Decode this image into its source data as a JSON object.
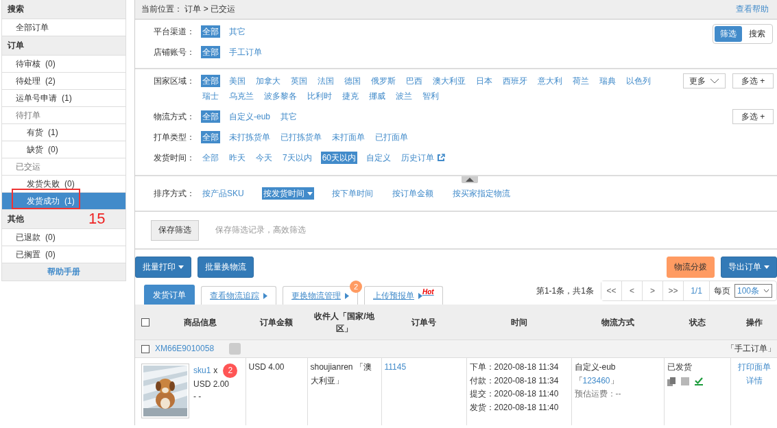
{
  "sidebar": {
    "sections": [
      {
        "title": "搜索",
        "items": [
          {
            "label": "全部订单",
            "selected": false
          }
        ]
      },
      {
        "title": "订单",
        "items": [
          {
            "label": "待审核",
            "count": "(0)",
            "selected": false
          },
          {
            "label": "待处理",
            "count": "(2)",
            "selected": false
          },
          {
            "label": "运单号申请",
            "count": "(1)",
            "selected": false
          },
          {
            "label": "待打单",
            "kind": "group",
            "selected": false,
            "children": [
              {
                "label": "有货",
                "count": "(1)",
                "selected": false
              },
              {
                "label": "缺货",
                "count": "(0)",
                "selected": false
              }
            ]
          },
          {
            "label": "已交运",
            "kind": "group",
            "selected": false,
            "children": [
              {
                "label": "发货失败",
                "count": "(0)",
                "selected": false
              },
              {
                "label": "发货成功",
                "count": "(1)",
                "selected": true
              }
            ]
          }
        ]
      },
      {
        "title": "其他",
        "items": [
          {
            "label": "已退款",
            "count": "(0)",
            "selected": false
          },
          {
            "label": "已搁置",
            "count": "(0)",
            "selected": false
          }
        ]
      }
    ],
    "help_link": "帮助手册",
    "annotation": {
      "label": "15"
    }
  },
  "breadcrumb": {
    "label": "当前位置：",
    "path": [
      "订单",
      "已交运"
    ],
    "separator": ">"
  },
  "help_link": "查看帮助",
  "filters": {
    "mode_toggle": [
      {
        "label": "筛选",
        "selected": true
      },
      {
        "label": "搜索",
        "selected": false
      }
    ],
    "groups": [
      {
        "rows": [
          {
            "label": "平台渠道：",
            "options": [
              {
                "label": "全部",
                "selected": true
              },
              {
                "label": "其它",
                "selected": false
              }
            ]
          },
          {
            "label": "店铺账号：",
            "options": [
              {
                "label": "全部",
                "selected": true
              },
              {
                "label": "手工订单",
                "selected": false
              }
            ]
          }
        ]
      },
      {
        "rows": [
          {
            "label": "国家区域：",
            "options": [
              {
                "label": "全部",
                "selected": true
              },
              {
                "label": "美国",
                "selected": false
              },
              {
                "label": "加拿大",
                "selected": false
              },
              {
                "label": "英国",
                "selected": false
              },
              {
                "label": "法国",
                "selected": false
              },
              {
                "label": "德国",
                "selected": false
              },
              {
                "label": "俄罗斯",
                "selected": false
              },
              {
                "label": "巴西",
                "selected": false
              },
              {
                "label": "澳大利亚",
                "selected": false
              },
              {
                "label": "日本",
                "selected": false
              },
              {
                "label": "西班牙",
                "selected": false
              },
              {
                "label": "意大利",
                "selected": false
              },
              {
                "label": "荷兰",
                "selected": false
              },
              {
                "label": "瑞典",
                "selected": false
              },
              {
                "label": "以色列",
                "selected": false
              },
              {
                "label": "瑞士",
                "selected": false
              },
              {
                "label": "乌克兰",
                "selected": false
              },
              {
                "label": "波多黎各",
                "selected": false
              },
              {
                "label": "比利时",
                "selected": false
              },
              {
                "label": "捷克",
                "selected": false
              },
              {
                "label": "挪威",
                "selected": false
              },
              {
                "label": "波兰",
                "selected": false
              },
              {
                "label": "智利",
                "selected": false
              }
            ],
            "buttons": [
              {
                "label": "更多",
                "kind": "dropdown"
              },
              {
                "label": "多选 +",
                "kind": "plain"
              }
            ]
          },
          {
            "label": "物流方式：",
            "options": [
              {
                "label": "全部",
                "selected": true
              },
              {
                "label": "自定义-eub",
                "selected": false
              },
              {
                "label": "其它",
                "selected": false
              }
            ],
            "buttons": [
              {
                "label": "多选 +",
                "kind": "plain"
              }
            ]
          },
          {
            "label": "打单类型：",
            "options": [
              {
                "label": "全部",
                "selected": true
              },
              {
                "label": "未打拣货单",
                "selected": false
              },
              {
                "label": "已打拣货单",
                "selected": false
              },
              {
                "label": "未打面单",
                "selected": false
              },
              {
                "label": "已打面单",
                "selected": false
              }
            ]
          },
          {
            "label": "发货时间：",
            "options": [
              {
                "label": "全部",
                "selected": false
              },
              {
                "label": "昨天",
                "selected": false
              },
              {
                "label": "今天",
                "selected": false
              },
              {
                "label": "7天以内",
                "selected": false
              },
              {
                "label": "60天以内",
                "selected": true
              },
              {
                "label": "自定义",
                "selected": false
              },
              {
                "label": "历史订单",
                "selected": false,
                "kind": "external"
              }
            ]
          }
        ]
      }
    ],
    "sort": {
      "label": "排序方式：",
      "options": [
        {
          "label": "按产品SKU",
          "selected": false
        },
        {
          "label": "按发货时间",
          "selected": true
        },
        {
          "label": "按下单时间",
          "selected": false
        },
        {
          "label": "按订单金额",
          "selected": false
        },
        {
          "label": "按买家指定物流",
          "selected": false
        }
      ]
    },
    "save_button": "保存筛选",
    "save_hint": "保存筛选记录，高效筛选"
  },
  "actions": {
    "left": [
      {
        "label": "批量打印",
        "kind": "primary",
        "dropdown": true
      },
      {
        "label": "批量换物流",
        "kind": "primary",
        "dropdown": false
      }
    ],
    "right": [
      {
        "label": "物流分拨",
        "kind": "warning",
        "dropdown": false
      },
      {
        "label": "导出订单",
        "kind": "primary",
        "dropdown": true
      }
    ]
  },
  "tabs": [
    {
      "label": "发货订单",
      "selected": true
    },
    {
      "label": "查看物流追踪",
      "selected": false,
      "arrow": true
    },
    {
      "label": "更换物流管理",
      "selected": false,
      "arrow": true,
      "badge": "2"
    },
    {
      "label": "上传预报单",
      "selected": false,
      "arrow": true,
      "tag": "Hot"
    }
  ],
  "pagination": {
    "summary": "第1-1条，共1条",
    "buttons": [
      "<<",
      "<",
      ">",
      ">>"
    ],
    "page": "1/1",
    "per_page_label": "每页",
    "per_page": "100条"
  },
  "table": {
    "select_all": false,
    "columns": [
      "商品信息",
      "订单金额",
      "收件人「国家/地区」",
      "订单号",
      "时间",
      "物流方式",
      "状态",
      "操作"
    ],
    "orders": [
      {
        "order_id": "XM66E9010058",
        "checked": false,
        "tag": "「手工订单」",
        "product": {
          "kind": "picture",
          "sku": "sku1",
          "multiplier": "x",
          "quantity": "2",
          "price": "USD 2.00",
          "note": "- -"
        },
        "amount": "USD 4.00",
        "recipient": "shoujianren 「澳大利亚」",
        "order_no": "11145",
        "times": [
          "下单：2020-08-18 11:34",
          "付款：2020-08-18 11:34",
          "提交：2020-08-18 11:40",
          "发货：2020-08-18 11:40"
        ],
        "logistics": {
          "method": "自定义-eub",
          "tracking_open": "「",
          "tracking": "123460",
          "tracking_close": "」",
          "fee": "预估运费：--"
        },
        "status": "已发货",
        "operations": [
          "打印面单",
          "详情"
        ]
      }
    ]
  }
}
